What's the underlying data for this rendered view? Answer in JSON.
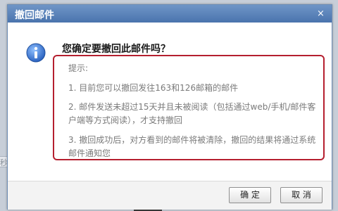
{
  "dialog": {
    "title": "撤回邮件",
    "close_icon": "×",
    "question": "您确定要撤回此邮件吗？"
  },
  "tips": {
    "label": "提示:",
    "items": [
      "1. 目前您可以撤回发往163和126邮箱的邮件",
      "2. 邮件发送未超过15天并且未被阅读（包括通过web/手机/邮件客户端等方式阅读），才支持撤回",
      "3. 撤回成功后，对方看到的邮件将被清除，撤回的结果将通过系统邮件通知您"
    ]
  },
  "buttons": {
    "ok": "确 定",
    "cancel": "取 消"
  },
  "background": {
    "glyph": "秒"
  },
  "colors": {
    "titlebar": "#4a74ad",
    "tip_border": "#b51f2f",
    "info_icon": "#3a7bd5"
  },
  "icons": {
    "info": "info-icon",
    "close": "close-icon"
  }
}
